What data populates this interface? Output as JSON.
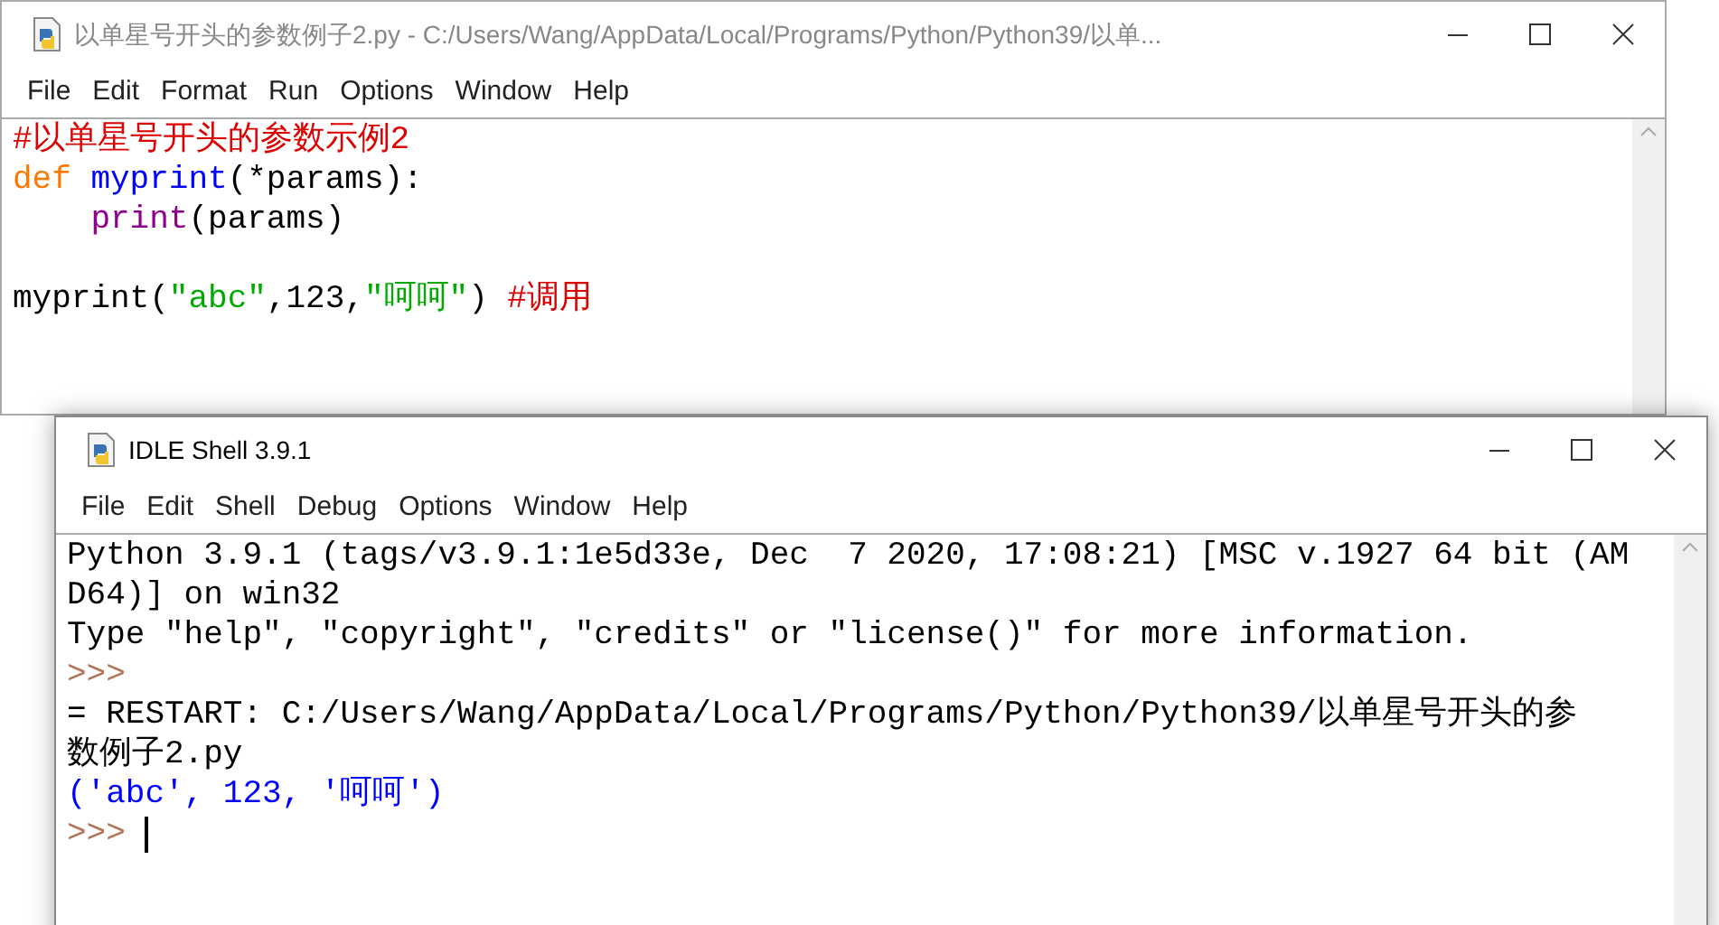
{
  "windows": [
    {
      "kind": "editor",
      "title": "以单星号开头的参数例子2.py - C:/Users/Wang/AppData/Local/Programs/Python/Python39/以单...",
      "active": false,
      "menu": [
        "File",
        "Edit",
        "Format",
        "Run",
        "Options",
        "Window",
        "Help"
      ],
      "lines": [
        {
          "kind": "code",
          "tokens": [
            {
              "kind": "comment",
              "text": "#以单星号开头的参数示例2"
            }
          ]
        },
        {
          "kind": "code",
          "tokens": [
            {
              "kind": "keyword",
              "text": "def"
            },
            {
              "kind": "definition",
              "text": " myprint"
            },
            {
              "kind": "plain",
              "text": "(*params):"
            }
          ]
        },
        {
          "kind": "code",
          "tokens": [
            {
              "kind": "builtin",
              "text": "    print"
            },
            {
              "kind": "plain",
              "text": "(params)"
            }
          ]
        },
        {
          "kind": "blank"
        },
        {
          "kind": "code",
          "tokens": [
            {
              "kind": "plain",
              "text": "myprint("
            },
            {
              "kind": "string",
              "text": "\"abc\""
            },
            {
              "kind": "plain",
              "text": ",123,"
            },
            {
              "kind": "string",
              "text": "\"呵呵\""
            },
            {
              "kind": "plain",
              "text": ") "
            },
            {
              "kind": "comment",
              "text": "#调用"
            }
          ]
        }
      ]
    },
    {
      "kind": "shell",
      "title": "IDLE Shell 3.9.1",
      "active": true,
      "menu": [
        "File",
        "Edit",
        "Shell",
        "Debug",
        "Options",
        "Window",
        "Help"
      ],
      "lines": [
        {
          "kind": "code",
          "tokens": [
            {
              "kind": "plain",
              "text": "Python 3.9.1 (tags/v3.9.1:1e5d33e, Dec  7 2020, 17:08:21) [MSC v.1927 64 bit (AM"
            }
          ]
        },
        {
          "kind": "code",
          "tokens": [
            {
              "kind": "plain",
              "text": "D64)] on win32"
            }
          ]
        },
        {
          "kind": "code",
          "tokens": [
            {
              "kind": "plain",
              "text": "Type \"help\", \"copyright\", \"credits\" or \"license()\" for more information."
            }
          ]
        },
        {
          "kind": "code",
          "tokens": [
            {
              "kind": "prompt",
              "text": ">>>"
            }
          ]
        },
        {
          "kind": "code",
          "tokens": [
            {
              "kind": "plain",
              "text": "= RESTART: C:/Users/Wang/AppData/Local/Programs/Python/Python39/以单星号开头的参"
            }
          ]
        },
        {
          "kind": "code",
          "tokens": [
            {
              "kind": "plain",
              "text": "数例子2.py"
            }
          ]
        },
        {
          "kind": "code",
          "tokens": [
            {
              "kind": "stdout",
              "text": "('abc', 123, '呵呵')"
            }
          ]
        },
        {
          "kind": "code",
          "cursor": true,
          "tokens": [
            {
              "kind": "prompt",
              "text": ">>>"
            }
          ]
        }
      ]
    }
  ]
}
